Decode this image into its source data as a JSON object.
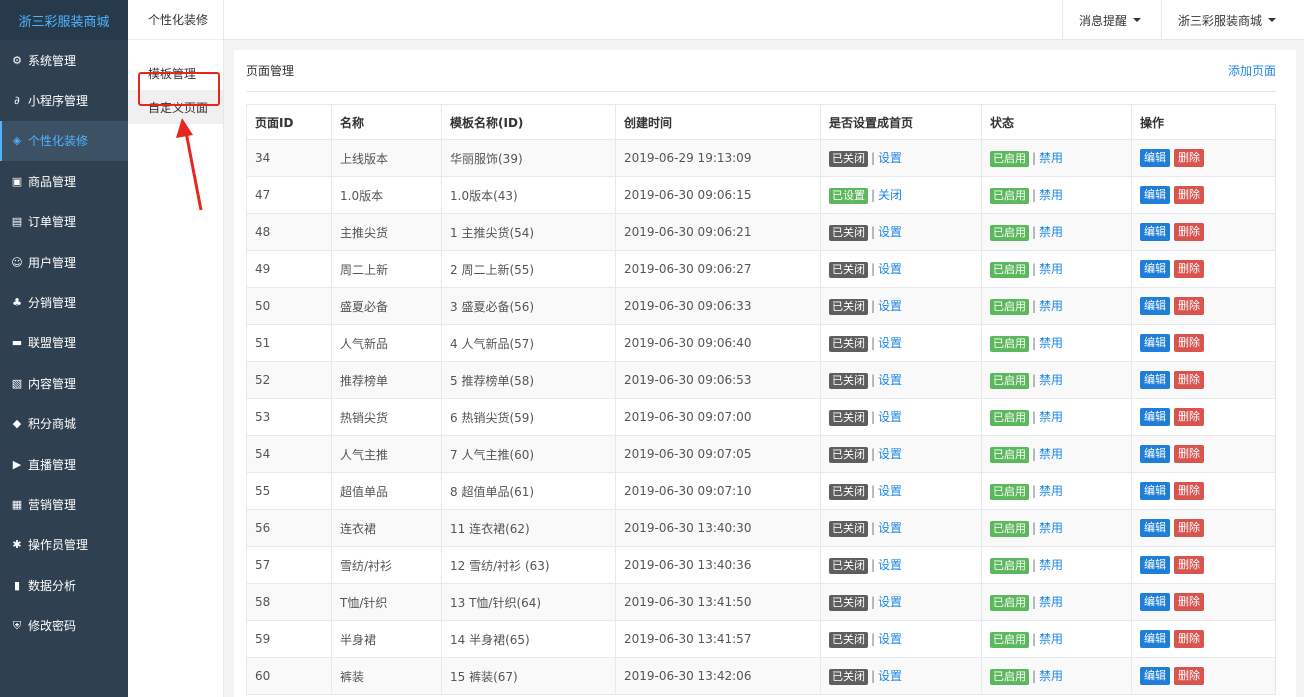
{
  "brand": "浙三彩服装商城",
  "sidebar": {
    "items": [
      {
        "label": "系统管理",
        "icon": "gear-icon",
        "glyph": "⚙"
      },
      {
        "label": "小程序管理",
        "icon": "link-icon",
        "glyph": "∂"
      },
      {
        "label": "个性化装修",
        "icon": "diamond-icon",
        "glyph": "◈"
      },
      {
        "label": "商品管理",
        "icon": "shop-icon",
        "glyph": "▣"
      },
      {
        "label": "订单管理",
        "icon": "clipboard-icon",
        "glyph": "▤"
      },
      {
        "label": "用户管理",
        "icon": "user-icon",
        "glyph": "☺"
      },
      {
        "label": "分销管理",
        "icon": "sitemap-icon",
        "glyph": "♣"
      },
      {
        "label": "联盟管理",
        "icon": "store-icon",
        "glyph": "▬"
      },
      {
        "label": "内容管理",
        "icon": "content-icon",
        "glyph": "▧"
      },
      {
        "label": "积分商城",
        "icon": "cube-icon",
        "glyph": "◆"
      },
      {
        "label": "直播管理",
        "icon": "play-icon",
        "glyph": "▶"
      },
      {
        "label": "营销管理",
        "icon": "marketing-icon",
        "glyph": "▦"
      },
      {
        "label": "操作员管理",
        "icon": "cog-icon",
        "glyph": "✱"
      },
      {
        "label": "数据分析",
        "icon": "bar-chart-icon",
        "glyph": "▮"
      },
      {
        "label": "修改密码",
        "icon": "shield-icon",
        "glyph": "⛨"
      }
    ]
  },
  "subnav": {
    "title": "个性化装修",
    "items": [
      "模板管理",
      "自定义页面"
    ]
  },
  "header": {
    "notifications": "消息提醒",
    "account": "浙三彩服装商城"
  },
  "panel": {
    "title": "页面管理",
    "add_label": "添加页面"
  },
  "table": {
    "columns": [
      "页面ID",
      "名称",
      "模板名称(ID)",
      "创建时间",
      "是否设置成首页",
      "状态",
      "操作"
    ],
    "rows": [
      {
        "id": "34",
        "name": "上线版本",
        "template": "华丽服饰(39)",
        "created": "2019-06-29 19:13:09",
        "home_badge": "已关闭",
        "home_action": "设置",
        "home_on": false,
        "status_badge": "已启用",
        "status_action": "禁用"
      },
      {
        "id": "47",
        "name": "1.0版本",
        "template": "1.0版本(43)",
        "created": "2019-06-30 09:06:15",
        "home_badge": "已设置",
        "home_action": "关闭",
        "home_on": true,
        "status_badge": "已启用",
        "status_action": "禁用"
      },
      {
        "id": "48",
        "name": "主推尖货",
        "template": "1 主推尖货(54)",
        "created": "2019-06-30 09:06:21",
        "home_badge": "已关闭",
        "home_action": "设置",
        "home_on": false,
        "status_badge": "已启用",
        "status_action": "禁用"
      },
      {
        "id": "49",
        "name": "周二上新",
        "template": "2 周二上新(55)",
        "created": "2019-06-30 09:06:27",
        "home_badge": "已关闭",
        "home_action": "设置",
        "home_on": false,
        "status_badge": "已启用",
        "status_action": "禁用"
      },
      {
        "id": "50",
        "name": "盛夏必备",
        "template": "3 盛夏必备(56)",
        "created": "2019-06-30 09:06:33",
        "home_badge": "已关闭",
        "home_action": "设置",
        "home_on": false,
        "status_badge": "已启用",
        "status_action": "禁用"
      },
      {
        "id": "51",
        "name": "人气新品",
        "template": "4 人气新品(57)",
        "created": "2019-06-30 09:06:40",
        "home_badge": "已关闭",
        "home_action": "设置",
        "home_on": false,
        "status_badge": "已启用",
        "status_action": "禁用"
      },
      {
        "id": "52",
        "name": "推荐榜单",
        "template": "5 推荐榜单(58)",
        "created": "2019-06-30 09:06:53",
        "home_badge": "已关闭",
        "home_action": "设置",
        "home_on": false,
        "status_badge": "已启用",
        "status_action": "禁用"
      },
      {
        "id": "53",
        "name": "热销尖货",
        "template": "6 热销尖货(59)",
        "created": "2019-06-30 09:07:00",
        "home_badge": "已关闭",
        "home_action": "设置",
        "home_on": false,
        "status_badge": "已启用",
        "status_action": "禁用"
      },
      {
        "id": "54",
        "name": "人气主推",
        "template": "7 人气主推(60)",
        "created": "2019-06-30 09:07:05",
        "home_badge": "已关闭",
        "home_action": "设置",
        "home_on": false,
        "status_badge": "已启用",
        "status_action": "禁用"
      },
      {
        "id": "55",
        "name": "超值单品",
        "template": "8 超值单品(61)",
        "created": "2019-06-30 09:07:10",
        "home_badge": "已关闭",
        "home_action": "设置",
        "home_on": false,
        "status_badge": "已启用",
        "status_action": "禁用"
      },
      {
        "id": "56",
        "name": "连衣裙",
        "template": "11 连衣裙(62)",
        "created": "2019-06-30 13:40:30",
        "home_badge": "已关闭",
        "home_action": "设置",
        "home_on": false,
        "status_badge": "已启用",
        "status_action": "禁用"
      },
      {
        "id": "57",
        "name": "雪纺/衬衫",
        "template": "12 雪纺/衬衫 (63)",
        "created": "2019-06-30 13:40:36",
        "home_badge": "已关闭",
        "home_action": "设置",
        "home_on": false,
        "status_badge": "已启用",
        "status_action": "禁用"
      },
      {
        "id": "58",
        "name": "T恤/针织",
        "template": "13 T恤/针织(64)",
        "created": "2019-06-30 13:41:50",
        "home_badge": "已关闭",
        "home_action": "设置",
        "home_on": false,
        "status_badge": "已启用",
        "status_action": "禁用"
      },
      {
        "id": "59",
        "name": "半身裙",
        "template": "14 半身裙(65)",
        "created": "2019-06-30 13:41:57",
        "home_badge": "已关闭",
        "home_action": "设置",
        "home_on": false,
        "status_badge": "已启用",
        "status_action": "禁用"
      },
      {
        "id": "60",
        "name": "裤装",
        "template": "15 裤装(67)",
        "created": "2019-06-30 13:42:06",
        "home_badge": "已关闭",
        "home_action": "设置",
        "home_on": false,
        "status_badge": "已启用",
        "status_action": "禁用"
      }
    ],
    "edit_label": "编辑",
    "delete_label": "删除"
  },
  "colors": {
    "sidebar_bg": "#2f4050",
    "accent": "#1e88e5",
    "badge_dark": "#5e5e5e",
    "badge_green": "#5cb85c",
    "delete_red": "#d9534f",
    "highlight_red": "#e6261f"
  }
}
